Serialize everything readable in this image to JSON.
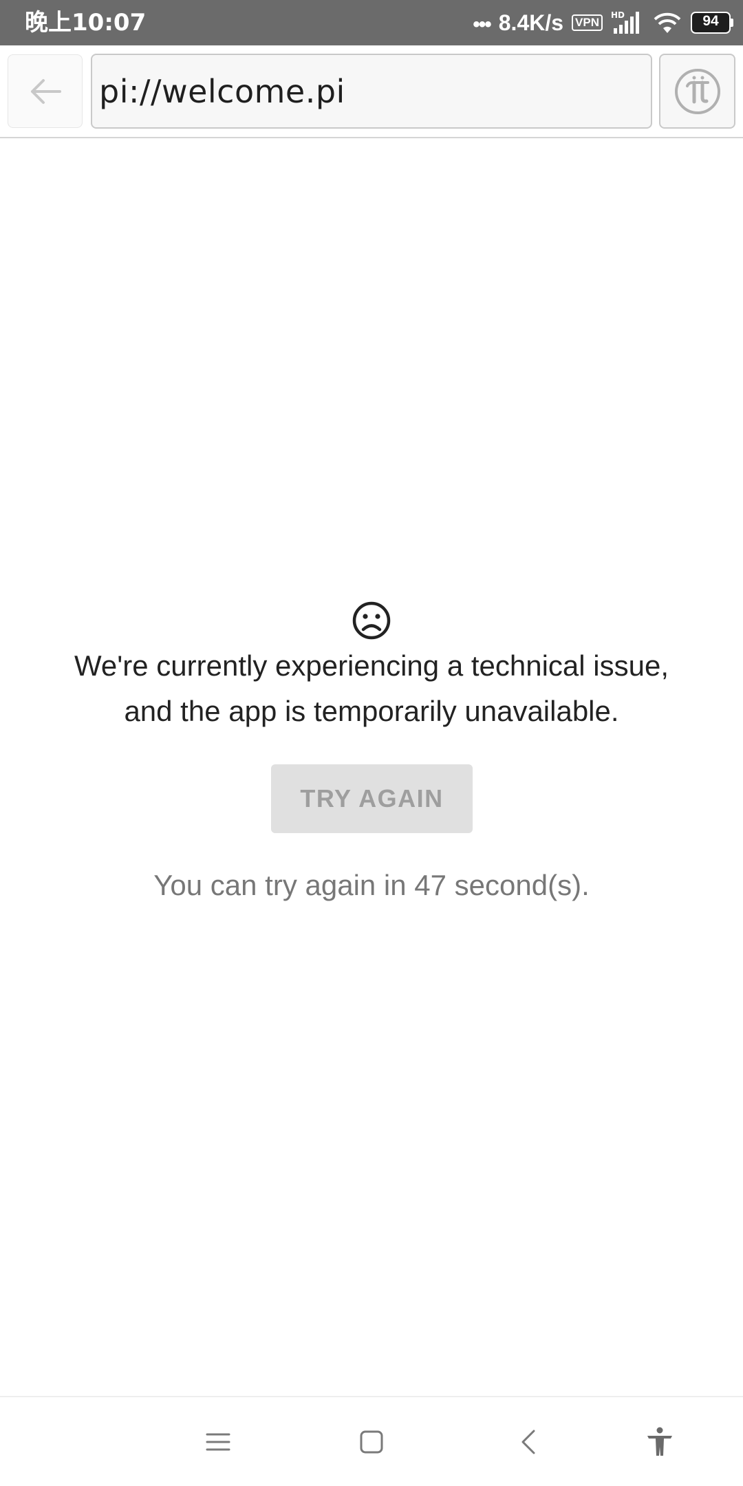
{
  "status_bar": {
    "time": "晚上10:07",
    "dots": "•••",
    "net_speed": "8.4K/s",
    "vpn": "VPN",
    "hd": "HD",
    "battery_level": "94",
    "icons": [
      "signal-icon",
      "wifi-icon",
      "battery-icon"
    ]
  },
  "toolbar": {
    "back_icon": "arrow-left-icon",
    "address": "pi://welcome.pi",
    "pi_icon": "pi-logo-icon"
  },
  "content": {
    "face_icon": "sad-face-icon",
    "message_line1": "We're currently experiencing a technical issue,",
    "message_line2": "and the app is temporarily unavailable.",
    "try_again_label": "TRY AGAIN",
    "countdown": "You can try again in 47 second(s)."
  },
  "nav_bar": {
    "icons": [
      "menu-icon",
      "home-icon",
      "back-icon",
      "accessibility-icon"
    ]
  },
  "colors": {
    "status_bar_bg": "#6b6b6b",
    "button_disabled_bg": "#e0e0e0",
    "button_disabled_text": "#9e9e9e",
    "message_text": "#222222",
    "countdown_text": "#777777"
  }
}
